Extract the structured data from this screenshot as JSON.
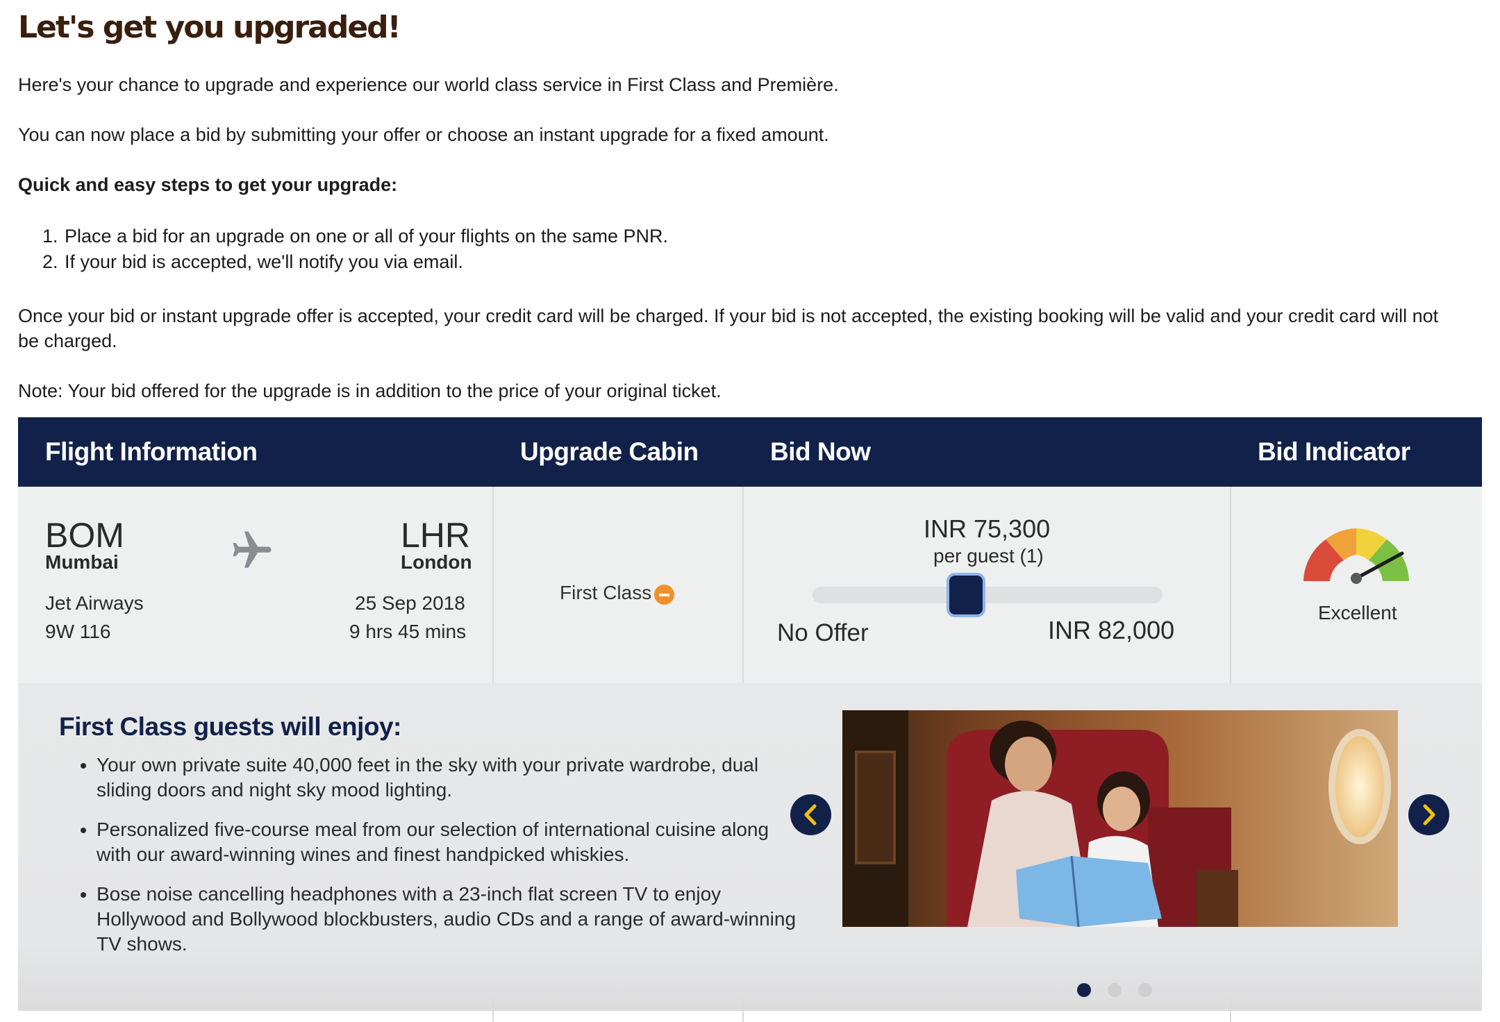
{
  "header": {
    "title": "Let's get you upgraded!"
  },
  "intro": {
    "p1": "Here's your chance to upgrade and experience our world class service in First Class and Première.",
    "p2": "You can now place a bid by submitting your offer or choose an instant upgrade for a fixed amount.",
    "steps_heading": "Quick and easy steps to get your upgrade:",
    "steps": [
      "Place a bid for an upgrade on one or all of your flights on the same PNR.",
      "If your bid is accepted, we'll notify you via email."
    ],
    "charge_line1": "Once your bid or instant upgrade offer is accepted, your credit card will be charged. If your bid is not accepted, the existing booking will be valid and your credit card will not",
    "charge_line2": "be charged.",
    "note": "Note: Your bid offered for the upgrade is in addition to the price of your original ticket."
  },
  "table": {
    "headers": [
      "Flight Information",
      "Upgrade Cabin",
      "Bid Now",
      "Bid Indicator"
    ],
    "flight": {
      "origin_code": "BOM",
      "origin_city": "Mumbai",
      "dest_code": "LHR",
      "dest_city": "London",
      "airline": "Jet Airways",
      "flight_number": "9W 116",
      "date": "25 Sep 2018",
      "duration": "9 hrs 45 mins",
      "icon": "airplane-icon"
    },
    "cabin": {
      "label": "First Class",
      "icon": "minus-circle-icon"
    },
    "bid": {
      "current": "INR 75,300",
      "per_guest": "per guest (1)",
      "min_label": "No Offer",
      "max_label": "INR 82,000",
      "slider_fraction": 0.5
    },
    "indicator": {
      "label": "Excellent",
      "icon": "gauge-icon"
    }
  },
  "benefits": {
    "heading": "First Class guests will enjoy:",
    "items": [
      "Your own private suite 40,000 feet in the sky with your private wardrobe, dual sliding doors and night sky mood lighting.",
      "Personalized five-course meal from our selection of international cuisine along with our award-winning wines and finest handpicked whiskies.",
      "Bose noise cancelling headphones with a 23-inch flat screen TV to enjoy Hollywood and Bollywood blockbusters, audio CDs and a range of award-winning TV shows."
    ],
    "carousel": {
      "prev_icon": "chevron-left-icon",
      "next_icon": "chevron-right-icon",
      "slide_count": 3,
      "active_slide": 1
    }
  },
  "colors": {
    "navy": "#11214a",
    "accent_orange": "#f0902a",
    "title_brown": "#3a1f0e",
    "slider_focus": "#8eb5ea"
  }
}
